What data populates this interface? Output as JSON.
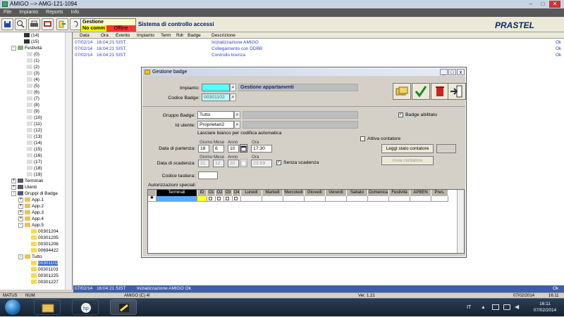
{
  "window": {
    "title": "AMIGO --> AMG-121-1094"
  },
  "menu": [
    "File",
    "Impianto",
    "Reports",
    "Info"
  ],
  "status": {
    "title": "Gestione appartamenti",
    "nocomm": "No comm",
    "offline": "Offline"
  },
  "system_title": "Sistema di controllo accessi",
  "brand": "PRASTEL",
  "tree": {
    "numbers_top": [
      "(14)",
      "(15)"
    ],
    "festivita_label": "Festività",
    "festivita_items": [
      "(0)",
      "(1)",
      "(2)",
      "(3)",
      "(4)",
      "(5)",
      "(6)",
      "(7)",
      "(8)",
      "(9)",
      "(10)",
      "(11)",
      "(12)",
      "(13)",
      "(14)",
      "(15)",
      "(16)",
      "(17)",
      "(18)",
      "(19)"
    ],
    "terminali": "Terminali",
    "utenti": "Utenti",
    "gruppi": "Gruppi di Badge",
    "apps": [
      "App.1",
      "App.2",
      "App.3",
      "App.4",
      "App.5"
    ],
    "app5_badges": [
      "00301204",
      "00301205",
      "00301206",
      "00694422"
    ],
    "tutto": "Tutto",
    "tutto_badges": [
      "00301102",
      "00301103",
      "00301225",
      "00301227"
    ]
  },
  "log": {
    "headers": [
      "Data",
      "Ora",
      "Evento",
      "Impianto",
      "Term",
      "Rdr",
      "Badge",
      "Descrizione"
    ],
    "rows": [
      {
        "data": "07/02/14",
        "ora": "16:04:21",
        "evento": "SIST.",
        "desc": "Inizializzazione AMIGO",
        "res": "Ok"
      },
      {
        "data": "07/02/14",
        "ora": "16:04:21",
        "evento": "SIST.",
        "desc": "Collegamento con DDBB",
        "res": "Ok"
      },
      {
        "data": "07/02/14",
        "ora": "16:04:21",
        "evento": "SIST.",
        "desc": "Controllo licenza",
        "res": "Ok"
      }
    ],
    "bottom": {
      "data": "07/02/14",
      "ora": "16:04:21",
      "evento": "SIST",
      "desc": "Inizializzazione AMIGO Ok",
      "res": "Ok"
    }
  },
  "appstatus": {
    "left": "MATUS",
    "num": "NUM",
    "center": "AMIGO (C) 4I",
    "ver": "Ver. 1.21",
    "date": "07/02/2014",
    "time": "16:11"
  },
  "taskbar": {
    "lang": "IT",
    "time": "16:11",
    "date": "07/02/2014"
  },
  "dialog": {
    "title": "Gestione badge",
    "impianto_label": "Impianto:",
    "impianto_value": "",
    "impianto_name": "Gestione appartamenti",
    "codice_label": "Codice Badge:",
    "codice_value": "00301102",
    "gruppo_label": "Gruppo Badge:",
    "gruppo_value": "Tutto",
    "badge_abilitato": "Badge abilitato",
    "idutente_label": "Id utente:",
    "idutente_value": "Proprietari2",
    "hint": "Lasciare bianco per codifica automatica",
    "attiva_contatore": "Attiva contatore",
    "partenza_label": "Data di partenza:",
    "scadenza_label": "Data di scadenza:",
    "sub_giorno": "Giorno",
    "sub_mese": "Mese",
    "sub_anno": "Anno",
    "sub_ora": "Ora",
    "partenza": {
      "giorno": "18",
      "mese": "6",
      "anno": "10",
      "ora": "17:30"
    },
    "scadenza": {
      "giorno": "31",
      "mese": "12",
      "anno": "20",
      "ora": "23:59"
    },
    "senza_scadenza": "Senza scadenza",
    "leggi_contatore": "Leggi stato contatore",
    "invia_contatore": "Invia contatore",
    "codice_tastiera_label": "Codice tastiera:",
    "autorizzazioni": "Autorizzazioni speciali",
    "grid_headers": [
      "Terminali",
      "ID",
      "O1",
      "O2",
      "O3",
      "O4",
      "Lunedì",
      "Martedì",
      "Mercoledì",
      "Giovedì",
      "Venerdì",
      "Sabato",
      "Domenica",
      "Festività",
      "APBEN",
      "Pres."
    ]
  }
}
